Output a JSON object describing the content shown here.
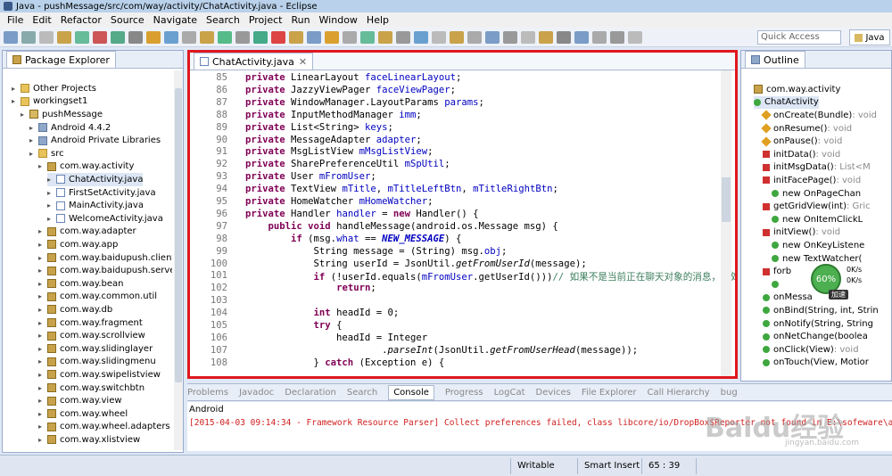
{
  "window": {
    "title": "Java - pushMessage/src/com/way/activity/ChatActivity.java - Eclipse"
  },
  "menu": [
    "File",
    "Edit",
    "Refactor",
    "Source",
    "Navigate",
    "Search",
    "Project",
    "Run",
    "Window",
    "Help"
  ],
  "toolbar": {
    "quick_access_placeholder": "Quick Access",
    "perspective": "Java"
  },
  "package_explorer": {
    "title": "Package Explorer",
    "items": [
      {
        "label": "Other Projects",
        "indent": 1,
        "icon": "folder"
      },
      {
        "label": "workingset1",
        "indent": 1,
        "icon": "folder"
      },
      {
        "label": "pushMessage",
        "indent": 2,
        "icon": "proj"
      },
      {
        "label": "Android 4.4.2",
        "indent": 3,
        "icon": "lib"
      },
      {
        "label": "Android Private Libraries",
        "indent": 3,
        "icon": "lib"
      },
      {
        "label": "src",
        "indent": 3,
        "icon": "folder"
      },
      {
        "label": "com.way.activity",
        "indent": 4,
        "icon": "pkg"
      },
      {
        "label": "ChatActivity.java",
        "indent": 5,
        "icon": "file"
      },
      {
        "label": "FirstSetActivity.java",
        "indent": 5,
        "icon": "file"
      },
      {
        "label": "MainActivity.java",
        "indent": 5,
        "icon": "file"
      },
      {
        "label": "WelcomeActivity.java",
        "indent": 5,
        "icon": "file"
      },
      {
        "label": "com.way.adapter",
        "indent": 4,
        "icon": "pkg"
      },
      {
        "label": "com.way.app",
        "indent": 4,
        "icon": "pkg"
      },
      {
        "label": "com.way.baidupush.client",
        "indent": 4,
        "icon": "pkg"
      },
      {
        "label": "com.way.baidupush.server",
        "indent": 4,
        "icon": "pkg"
      },
      {
        "label": "com.way.bean",
        "indent": 4,
        "icon": "pkg"
      },
      {
        "label": "com.way.common.util",
        "indent": 4,
        "icon": "pkg"
      },
      {
        "label": "com.way.db",
        "indent": 4,
        "icon": "pkg"
      },
      {
        "label": "com.way.fragment",
        "indent": 4,
        "icon": "pkg"
      },
      {
        "label": "com.way.scrollview",
        "indent": 4,
        "icon": "pkg"
      },
      {
        "label": "com.way.slidinglayer",
        "indent": 4,
        "icon": "pkg"
      },
      {
        "label": "com.way.slidingmenu",
        "indent": 4,
        "icon": "pkg"
      },
      {
        "label": "com.way.swipelistview",
        "indent": 4,
        "icon": "pkg"
      },
      {
        "label": "com.way.switchbtn",
        "indent": 4,
        "icon": "pkg"
      },
      {
        "label": "com.way.view",
        "indent": 4,
        "icon": "pkg"
      },
      {
        "label": "com.way.wheel",
        "indent": 4,
        "icon": "pkg"
      },
      {
        "label": "com.way.wheel.adapters",
        "indent": 4,
        "icon": "pkg"
      },
      {
        "label": "com.way.xlistview",
        "indent": 4,
        "icon": "pkg"
      }
    ]
  },
  "editor": {
    "tab": "ChatActivity.java",
    "lines": [
      {
        "n": "85",
        "code": [
          [
            "kw",
            "private "
          ],
          [
            "",
            "LinearLayout "
          ],
          [
            "fd",
            "faceLinearLayout"
          ],
          [
            "",
            ";"
          ]
        ]
      },
      {
        "n": "86",
        "code": [
          [
            "kw",
            "private "
          ],
          [
            "",
            "JazzyViewPager "
          ],
          [
            "fd",
            "faceViewPager"
          ],
          [
            "",
            ";"
          ]
        ]
      },
      {
        "n": "87",
        "code": [
          [
            "kw",
            "private "
          ],
          [
            "",
            "WindowManager.LayoutParams "
          ],
          [
            "fd",
            "params"
          ],
          [
            "",
            ";"
          ]
        ]
      },
      {
        "n": "88",
        "code": [
          [
            "kw",
            "private "
          ],
          [
            "",
            "InputMethodManager "
          ],
          [
            "fd",
            "imm"
          ],
          [
            "",
            ";"
          ]
        ]
      },
      {
        "n": "89",
        "code": [
          [
            "kw",
            "private "
          ],
          [
            "",
            "List<String> "
          ],
          [
            "fd",
            "keys"
          ],
          [
            "",
            ";"
          ]
        ]
      },
      {
        "n": "90",
        "code": [
          [
            "kw",
            "private "
          ],
          [
            "",
            "MessageAdapter "
          ],
          [
            "fd",
            "adapter"
          ],
          [
            "",
            ";"
          ]
        ]
      },
      {
        "n": "91",
        "code": [
          [
            "kw",
            "private "
          ],
          [
            "",
            "MsgListView "
          ],
          [
            "fd",
            "mMsgListView"
          ],
          [
            "",
            ";"
          ]
        ]
      },
      {
        "n": "92",
        "code": [
          [
            "kw",
            "private "
          ],
          [
            "",
            "SharePreferenceUtil "
          ],
          [
            "fd",
            "mSpUtil"
          ],
          [
            "",
            ";"
          ]
        ]
      },
      {
        "n": "93",
        "code": [
          [
            "kw",
            "private "
          ],
          [
            "",
            "User "
          ],
          [
            "fd",
            "mFromUser"
          ],
          [
            "",
            ";"
          ]
        ]
      },
      {
        "n": "94",
        "code": [
          [
            "kw",
            "private "
          ],
          [
            "",
            "TextView "
          ],
          [
            "fd",
            "mTitle"
          ],
          [
            "",
            ", "
          ],
          [
            "fd",
            "mTitleLeftBtn"
          ],
          [
            "",
            ", "
          ],
          [
            "fd",
            "mTitleRightBtn"
          ],
          [
            "",
            ";"
          ]
        ]
      },
      {
        "n": "95",
        "code": [
          [
            "kw",
            "private "
          ],
          [
            "",
            "HomeWatcher "
          ],
          [
            "fd",
            "mHomeWatcher"
          ],
          [
            "",
            ";"
          ]
        ]
      },
      {
        "n": "96",
        "code": [
          [
            "kw",
            "private "
          ],
          [
            "",
            "Handler "
          ],
          [
            "fd",
            "handler"
          ],
          [
            "",
            " = "
          ],
          [
            "kw",
            "new "
          ],
          [
            "",
            "Handler() {"
          ]
        ]
      },
      {
        "n": "97",
        "code": [
          [
            "",
            "    "
          ],
          [
            "kw",
            "public void "
          ],
          [
            "",
            "handleMessage(android.os.Message msg) {"
          ]
        ]
      },
      {
        "n": "98",
        "code": [
          [
            "",
            "        "
          ],
          [
            "kw",
            "if "
          ],
          [
            "",
            "(msg."
          ],
          [
            "fd",
            "what"
          ],
          [
            "",
            " == "
          ],
          [
            "st",
            "NEW_MESSAGE"
          ],
          [
            "",
            ") {"
          ]
        ]
      },
      {
        "n": "99",
        "code": [
          [
            "",
            "            String message = (String) msg."
          ],
          [
            "fd",
            "obj"
          ],
          [
            "",
            ";"
          ]
        ]
      },
      {
        "n": "100",
        "code": [
          [
            "",
            "            String userId = JsonUtil."
          ],
          [
            "it",
            "getFromUserId"
          ],
          [
            "",
            "(message);"
          ]
        ]
      },
      {
        "n": "101",
        "code": [
          [
            "",
            "            "
          ],
          [
            "kw",
            "if "
          ],
          [
            "",
            "(!userId.equals("
          ],
          [
            "fd",
            "mFromUser"
          ],
          [
            "",
            ".getUserId()))"
          ],
          [
            "cm",
            "// 如果不是当前正在聊天对象的消息，不处"
          ]
        ]
      },
      {
        "n": "102",
        "code": [
          [
            "",
            "                "
          ],
          [
            "kw",
            "return"
          ],
          [
            "",
            ";"
          ]
        ]
      },
      {
        "n": "103",
        "code": [
          [
            "",
            ""
          ]
        ]
      },
      {
        "n": "104",
        "code": [
          [
            "",
            "            "
          ],
          [
            "kw",
            "int "
          ],
          [
            "",
            "headId = 0;"
          ]
        ]
      },
      {
        "n": "105",
        "code": [
          [
            "",
            "            "
          ],
          [
            "kw",
            "try "
          ],
          [
            "",
            "{"
          ]
        ]
      },
      {
        "n": "106",
        "code": [
          [
            "",
            "                headId = Integer"
          ]
        ]
      },
      {
        "n": "107",
        "code": [
          [
            "",
            "                        ."
          ],
          [
            "it",
            "parseInt"
          ],
          [
            "",
            "(JsonUtil."
          ],
          [
            "it",
            "getFromUserHead"
          ],
          [
            "",
            "(message));"
          ]
        ]
      },
      {
        "n": "108",
        "code": [
          [
            "",
            "            } "
          ],
          [
            "kw",
            "catch "
          ],
          [
            "",
            "(Exception e) {"
          ]
        ]
      }
    ]
  },
  "outline": {
    "title": "Outline",
    "items": [
      {
        "label": "com.way.activity",
        "ret": "",
        "icon": "pkg",
        "indent": 1
      },
      {
        "label": "ChatActivity",
        "ret": "",
        "icon": "class",
        "indent": 1
      },
      {
        "label": "onCreate(Bundle)",
        "ret": " : void",
        "icon": "diam",
        "indent": 2
      },
      {
        "label": "onResume()",
        "ret": " : void",
        "icon": "diam",
        "indent": 2
      },
      {
        "label": "onPause()",
        "ret": " : void",
        "icon": "diam",
        "indent": 2
      },
      {
        "label": "initData()",
        "ret": " : void",
        "icon": "red",
        "indent": 2
      },
      {
        "label": "initMsgData()",
        "ret": " : List<M",
        "icon": "red",
        "indent": 2
      },
      {
        "label": "initFacePage()",
        "ret": " : void",
        "icon": "red",
        "indent": 2
      },
      {
        "label": "new OnPageChan",
        "ret": "",
        "icon": "green",
        "indent": 3
      },
      {
        "label": "getGridView(int)",
        "ret": " : Gric",
        "icon": "red",
        "indent": 2
      },
      {
        "label": "new OnItemClickL",
        "ret": "",
        "icon": "green",
        "indent": 3
      },
      {
        "label": "initView()",
        "ret": " : void",
        "icon": "red",
        "indent": 2
      },
      {
        "label": "new OnKeyListene",
        "ret": "",
        "icon": "green",
        "indent": 3
      },
      {
        "label": "new TextWatcher(",
        "ret": "",
        "icon": "green",
        "indent": 3
      },
      {
        "label": "forb",
        "ret": "",
        "icon": "red",
        "indent": 2
      },
      {
        "label": "",
        "ret": "",
        "icon": "green",
        "indent": 3
      },
      {
        "label": "onMessa",
        "ret": "",
        "icon": "green",
        "indent": 2
      },
      {
        "label": "onBind(String, int, Strin",
        "ret": "",
        "icon": "green",
        "indent": 2
      },
      {
        "label": "onNotify(String, String",
        "ret": "",
        "icon": "green",
        "indent": 2
      },
      {
        "label": "onNetChange(boolea",
        "ret": "",
        "icon": "green",
        "indent": 2
      },
      {
        "label": "onClick(View)",
        "ret": " : void",
        "icon": "green",
        "indent": 2
      },
      {
        "label": "onTouch(View, Motior",
        "ret": "",
        "icon": "green",
        "indent": 2
      }
    ]
  },
  "net_widget": {
    "percent": "60%",
    "up": "0K/s",
    "down": "0K/s",
    "label": "加速"
  },
  "console": {
    "tabs": [
      "Problems",
      "Javadoc",
      "Declaration",
      "Search",
      "Console",
      "Progress",
      "LogCat",
      "Devices",
      "File Explorer",
      "Call Hierarchy",
      "bug"
    ],
    "active": "Console",
    "name": "Android",
    "log": "[2015-04-03 09:14:34 - Framework Resource Parser] Collect preferences failed, class libcore/io/DropBox$Reporter not found in E:\\sofeware\\adt-bundle-wi"
  },
  "status": {
    "writable": "Writable",
    "insert_mode": "Smart Insert",
    "position": "65 : 39"
  },
  "watermark": {
    "text": "Baidu经验",
    "sub": "jingyan.baidu.com"
  },
  "colors": {
    "highlight_border": "#e0171f",
    "keyword": "#7f0055",
    "field": "#0000c0",
    "comment": "#3f7f5f",
    "error": "#d02020"
  }
}
